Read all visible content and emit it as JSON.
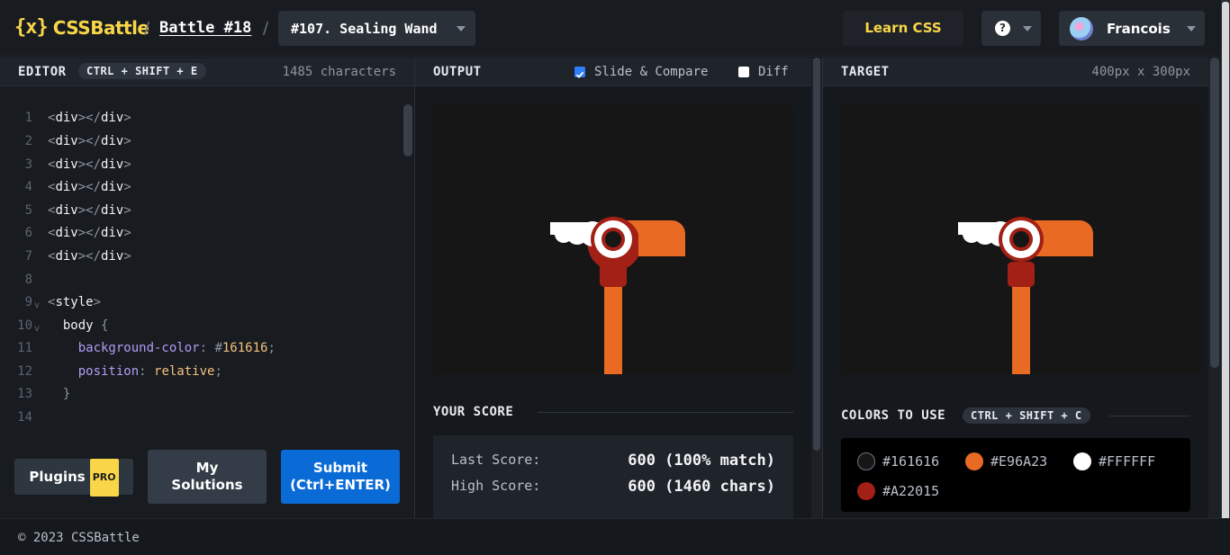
{
  "header": {
    "logo_mark": "{x}",
    "logo_text": "CSSBattle",
    "battle_link": "Battle #18",
    "target_select": "#107. Sealing Wand",
    "learn_css": "Learn CSS",
    "help_icon_text": "?",
    "user_name": "Francois"
  },
  "editor": {
    "title": "EDITOR",
    "shortcut": "CTRL + SHIFT + E",
    "char_count": "1485 characters",
    "lines": [
      {
        "n": "1"
      },
      {
        "n": "2"
      },
      {
        "n": "3"
      },
      {
        "n": "4"
      },
      {
        "n": "5"
      },
      {
        "n": "6"
      },
      {
        "n": "7"
      },
      {
        "n": "8"
      },
      {
        "n": "9"
      },
      {
        "n": "10"
      },
      {
        "n": "11"
      },
      {
        "n": "12"
      },
      {
        "n": "13"
      },
      {
        "n": "14"
      }
    ],
    "code": {
      "div_open": "div",
      "div_close": "div",
      "style_tag": "style",
      "body_sel": "body",
      "prop1": "background-color",
      "val1_hash": "#",
      "val1": "161616",
      "prop2": "position",
      "val2": "relative"
    },
    "plugins_label": "Plugins",
    "pro_badge": "PRO",
    "my_solutions_line1": "My",
    "my_solutions_line2": "Solutions",
    "submit_line1": "Submit",
    "submit_line2": "(Ctrl+ENTER)"
  },
  "output": {
    "title": "OUTPUT",
    "slide_compare": "Slide & Compare",
    "slide_compare_checked": true,
    "diff": "Diff",
    "diff_checked": false
  },
  "score": {
    "title": "YOUR SCORE",
    "last_label": "Last Score:",
    "last_value": "600 (100% match)",
    "high_label": "High Score:",
    "high_value": "600 (1460 chars)"
  },
  "target": {
    "title": "TARGET",
    "size": "400px x 300px"
  },
  "colors": {
    "title": "COLORS TO USE",
    "shortcut": "CTRL + SHIFT + C",
    "swatches": [
      {
        "hex": "#161616",
        "label": "#161616"
      },
      {
        "hex": "#E96A23",
        "label": "#E96A23"
      },
      {
        "hex": "#FFFFFF",
        "label": "#FFFFFF"
      },
      {
        "hex": "#A22015",
        "label": "#A22015"
      }
    ]
  },
  "footer": {
    "copyright": "© 2023 CSSBattle"
  }
}
